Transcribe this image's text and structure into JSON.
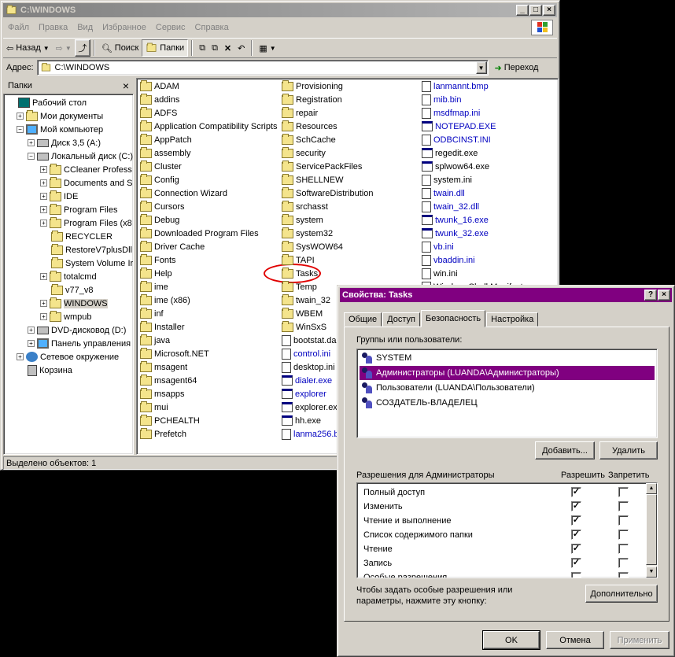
{
  "explorer": {
    "title": "C:\\WINDOWS",
    "menu": [
      "Файл",
      "Правка",
      "Вид",
      "Избранное",
      "Сервис",
      "Справка"
    ],
    "toolbar": {
      "back": "Назад",
      "search": "Поиск",
      "folders": "Папки"
    },
    "address_label": "Адрес:",
    "address_value": "C:\\WINDOWS",
    "go_label": "Переход",
    "pane_title": "Папки",
    "pane_close": "×",
    "status": "Выделено объектов: 1",
    "tree": [
      {
        "label": "Рабочий стол",
        "icon": "desk",
        "pm": ""
      },
      {
        "label": "Мои документы",
        "icon": "folder",
        "pm": "+"
      },
      {
        "label": "Мой компьютер",
        "icon": "pc",
        "pm": "−"
      },
      {
        "label": "Диск 3,5 (A:)",
        "icon": "drive",
        "pm": "+"
      },
      {
        "label": "Локальный диск (C:)",
        "icon": "drive",
        "pm": "−"
      },
      {
        "label": "CCleaner Profess",
        "icon": "folder",
        "pm": "+"
      },
      {
        "label": "Documents and S",
        "icon": "folder",
        "pm": "+"
      },
      {
        "label": "IDE",
        "icon": "folder",
        "pm": "+"
      },
      {
        "label": "Program Files",
        "icon": "folder",
        "pm": "+"
      },
      {
        "label": "Program Files (x8",
        "icon": "folder",
        "pm": "+"
      },
      {
        "label": "RECYCLER",
        "icon": "folder",
        "pm": ""
      },
      {
        "label": "RestoreV7plusDll",
        "icon": "folder",
        "pm": ""
      },
      {
        "label": "System Volume Ir",
        "icon": "folder",
        "pm": ""
      },
      {
        "label": "totalcmd",
        "icon": "folder",
        "pm": "+"
      },
      {
        "label": "v77_v8",
        "icon": "folder",
        "pm": ""
      },
      {
        "label": "WINDOWS",
        "icon": "folder",
        "pm": "+"
      },
      {
        "label": "wmpub",
        "icon": "folder",
        "pm": "+"
      },
      {
        "label": "DVD-дисковод (D:)",
        "icon": "drive",
        "pm": "+"
      },
      {
        "label": "Панель управления",
        "icon": "pc",
        "pm": "+"
      },
      {
        "label": "Сетевое окружение",
        "icon": "net",
        "pm": "+"
      },
      {
        "label": "Корзина",
        "icon": "bin",
        "pm": ""
      }
    ],
    "files_col1": [
      "ADAM",
      "addins",
      "ADFS",
      "Application Compatibility Scripts",
      "AppPatch",
      "assembly",
      "Cluster",
      "Config",
      "Connection Wizard",
      "Cursors",
      "Debug",
      "Downloaded Program Files",
      "Driver Cache",
      "Fonts",
      "Help",
      "ime",
      "ime (x86)",
      "inf",
      "Installer",
      "java",
      "Microsoft.NET",
      "msagent",
      "msagent64",
      "msapps",
      "mui",
      "PCHEALTH",
      "Prefetch"
    ],
    "files_col2": [
      "Provisioning",
      "Registration",
      "repair",
      "Resources",
      "SchCache",
      "security",
      "ServicePackFiles",
      "SHELLNEW",
      "SoftwareDistribution",
      "srchasst",
      "system",
      "system32",
      "SysWOW64",
      "TAPI",
      "Tasks",
      "Temp",
      "twain_32",
      "WBEM",
      "WinSxS",
      "bootstat.da",
      "control.ini",
      "desktop.ini",
      "dialer.exe",
      "explorer",
      "explorer.exe",
      "hh.exe",
      "lanma256.b"
    ],
    "files_col3": [
      "lanmannt.bmp",
      "mib.bin",
      "msdfmap.ini",
      "NOTEPAD.EXE",
      "ODBCINST.INI",
      "regedit.exe",
      "splwow64.exe",
      "system.ini",
      "twain.dll",
      "twain_32.dll",
      "twunk_16.exe",
      "twunk_32.exe",
      "vb.ini",
      "vbaddin.ini",
      "win.ini",
      "WindowsShell.Manifest"
    ]
  },
  "dialog": {
    "title": "Свойства: Tasks",
    "help_btn": "?",
    "close_btn": "×",
    "tabs": [
      "Общие",
      "Доступ",
      "Безопасность",
      "Настройка"
    ],
    "groups_label": "Группы или пользователи:",
    "users": [
      "SYSTEM",
      "Администраторы (LUANDA\\Администраторы)",
      "Пользователи (LUANDA\\Пользователи)",
      "СОЗДАТЕЛЬ-ВЛАДЕЛЕЦ"
    ],
    "add_btn": "Добавить...",
    "remove_btn": "Удалить",
    "perm_label": "Разрешения для Администраторы",
    "allow_label": "Разрешить",
    "deny_label": "Запретить",
    "permissions": [
      {
        "name": "Полный доступ",
        "allow": true,
        "deny": false
      },
      {
        "name": "Изменить",
        "allow": true,
        "deny": false
      },
      {
        "name": "Чтение и выполнение",
        "allow": true,
        "deny": false
      },
      {
        "name": "Список содержимого папки",
        "allow": true,
        "deny": false
      },
      {
        "name": "Чтение",
        "allow": true,
        "deny": false
      },
      {
        "name": "Запись",
        "allow": true,
        "deny": false
      },
      {
        "name": "Особые разрешения",
        "allow": false,
        "deny": false
      }
    ],
    "advanced_text": "Чтобы задать особые разрешения или параметры, нажмите эту кнопку:",
    "advanced_btn": "Дополнительно",
    "ok_btn": "OK",
    "cancel_btn": "Отмена",
    "apply_btn": "Применить"
  }
}
